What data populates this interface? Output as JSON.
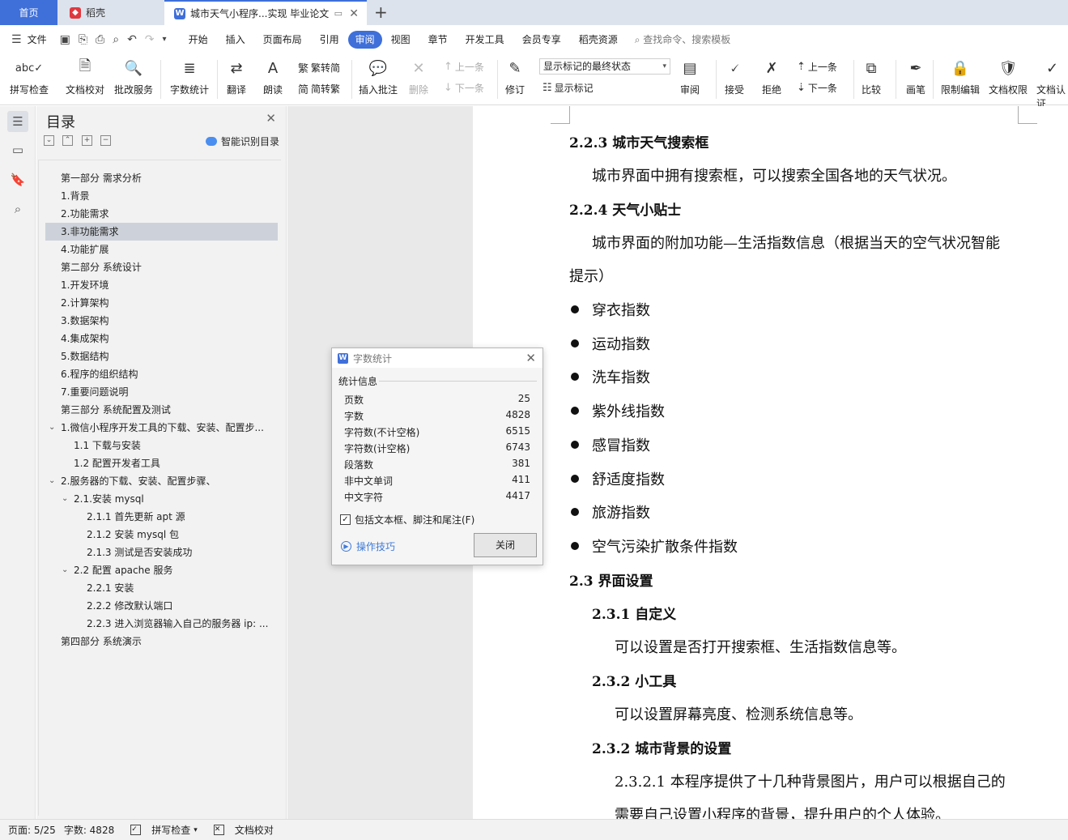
{
  "tabs": {
    "home": "首页",
    "docer": "稻壳",
    "doc": "城市天气小程序...实现 毕业论文"
  },
  "menu": {
    "file": "文件",
    "items": [
      "开始",
      "插入",
      "页面布局",
      "引用",
      "审阅",
      "视图",
      "章节",
      "开发工具",
      "会员专享",
      "稻壳资源"
    ],
    "active": "审阅",
    "search": "查找命令、搜索模板"
  },
  "ribbon": {
    "spell": "拼写检查",
    "proofread": "文档校对",
    "batch": "批改服务",
    "wordcount": "字数统计",
    "translate": "翻译",
    "read": "朗读",
    "trad": "繁转简",
    "simp": "简转繁",
    "insert_comment": "插入批注",
    "delete": "删除",
    "prev": "上一条",
    "next": "下一条",
    "track": "修订",
    "markup_select": "显示标记的最终状态",
    "show_markup": "显示标记",
    "review": "审阅",
    "accept": "接受",
    "reject": "拒绝",
    "prev2": "上一条",
    "next2": "下一条",
    "compare": "比较",
    "ink": "画笔",
    "restrict": "限制编辑",
    "permission": "文档权限",
    "cert": "文档认证"
  },
  "toc": {
    "title": "目录",
    "smart": "智能识别目录",
    "items": [
      {
        "text": "第一部分  需求分析",
        "level": 0
      },
      {
        "text": "1.背景",
        "level": 0
      },
      {
        "text": "2.功能需求",
        "level": 0
      },
      {
        "text": "3.非功能需求",
        "level": 0,
        "selected": true
      },
      {
        "text": "4.功能扩展",
        "level": 0
      },
      {
        "text": "第二部分  系统设计",
        "level": 0
      },
      {
        "text": "1.开发环境",
        "level": 0
      },
      {
        "text": "2.计算架构",
        "level": 0
      },
      {
        "text": "3.数据架构",
        "level": 0
      },
      {
        "text": "4.集成架构",
        "level": 0
      },
      {
        "text": "5.数据结构",
        "level": 0
      },
      {
        "text": "6.程序的组织结构",
        "level": 0
      },
      {
        "text": "7.重要问题说明",
        "level": 0
      },
      {
        "text": "第三部分  系统配置及测试",
        "level": 0
      },
      {
        "text": "1.微信小程序开发工具的下载、安装、配置步...",
        "level": 0,
        "expand": true
      },
      {
        "text": "1.1 下载与安装",
        "level": 1
      },
      {
        "text": "1.2 配置开发者工具",
        "level": 1
      },
      {
        "text": "2.服务器的下载、安装、配置步骤、",
        "level": 0,
        "expand": true
      },
      {
        "text": "2.1.安装 mysql",
        "level": 1,
        "expand": true
      },
      {
        "text": "2.1.1 首先更新 apt 源",
        "level": 2
      },
      {
        "text": "2.1.2 安装 mysql 包",
        "level": 2
      },
      {
        "text": "2.1.3 测试是否安装成功",
        "level": 2
      },
      {
        "text": "2.2 配置 apache 服务",
        "level": 1,
        "expand": true
      },
      {
        "text": "2.2.1 安装",
        "level": 2
      },
      {
        "text": "2.2.2 修改默认端口",
        "level": 2
      },
      {
        "text": "2.2.3 进入浏览器输入自己的服务器 ip: ...",
        "level": 2
      },
      {
        "text": "第四部分  系统演示",
        "level": 0
      }
    ]
  },
  "doc": {
    "h223": "2.2.3 城市天气搜索框",
    "p223": "城市界面中拥有搜索框，可以搜索全国各地的天气状况。",
    "h224": "2.2.4 天气小贴士",
    "p224a": "城市界面的附加功能—生活指数信息（根据当天的空气状况智能",
    "p224b": "提示）",
    "bullets": [
      "穿衣指数",
      "运动指数",
      "洗车指数",
      "紫外线指数",
      "感冒指数",
      "舒适度指数",
      "旅游指数",
      "空气污染扩散条件指数"
    ],
    "h23": "2.3 界面设置",
    "h231": "2.3.1 自定义",
    "p231": "可以设置是否打开搜索框、生活指数信息等。",
    "h232a": "2.3.2 小工具",
    "p232a": "可以设置屏幕亮度、检测系统信息等。",
    "h232b": "2.3.2 城市背景的设置",
    "p2321a": "2.3.2.1 本程序提供了十几种背景图片，用户可以根据自己的",
    "p2321b": "需要自己设置小程序的背景，提升用户的个人体验。"
  },
  "dialog": {
    "title": "字数统计",
    "section": "统计信息",
    "stats": [
      {
        "label": "页数",
        "value": "25"
      },
      {
        "label": "字数",
        "value": "4828"
      },
      {
        "label": "字符数(不计空格)",
        "value": "6515"
      },
      {
        "label": "字符数(计空格)",
        "value": "6743"
      },
      {
        "label": "段落数",
        "value": "381"
      },
      {
        "label": "非中文单词",
        "value": "411"
      },
      {
        "label": "中文字符",
        "value": "4417"
      }
    ],
    "checkbox": "包括文本框、脚注和尾注(F)",
    "checked": true,
    "tips": "操作技巧",
    "close": "关闭"
  },
  "status": {
    "page": "页面: 5/25",
    "words": "字数: 4828",
    "spell": "拼写检查",
    "proof": "文档校对"
  },
  "colors": {
    "accent": "#3f6fd9",
    "tab_bar": "#dde3ed",
    "panel": "#f2f2f2",
    "selected_row": "#cdd2da"
  }
}
